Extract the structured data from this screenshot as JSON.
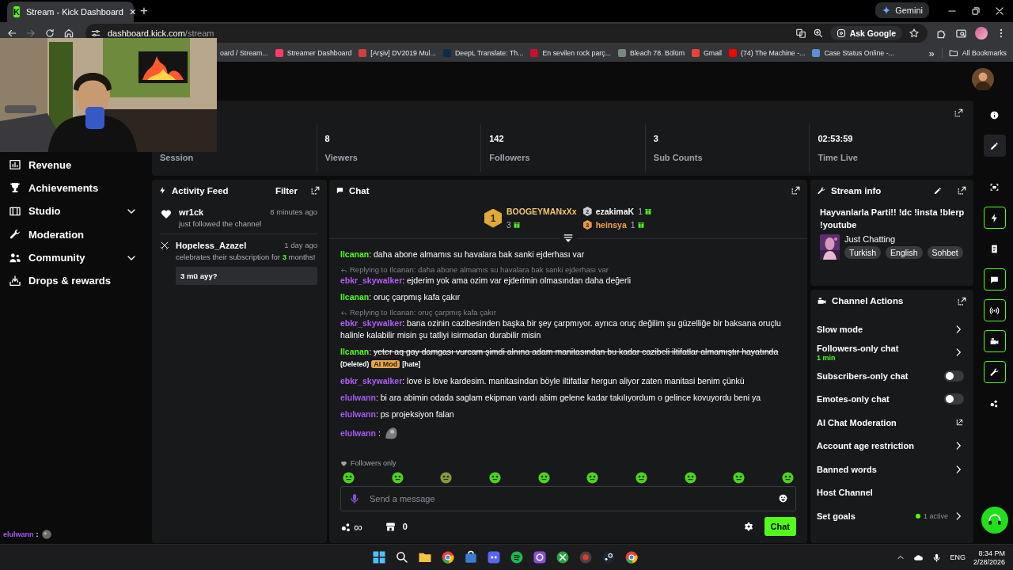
{
  "browser": {
    "tabs": [
      {
        "logo": "K",
        "title": "Stream - Kick Dashboard",
        "close": "×",
        "selected": true
      }
    ],
    "new_tab": "+",
    "gemini": "Gemini",
    "address": {
      "host": "dashboard.kick.com",
      "path": "/stream"
    },
    "ask_google": "Ask Google",
    "bookmarks": [
      "oard / Stream...",
      "Streamer Dashboard",
      "[Arşiv] DV2019 Mul...",
      "DeepL Translate: Th...",
      "En sevilen rock parç...",
      "Bleach 78. Bölüm",
      "Gmail",
      "(74) The Machine -...",
      "Case Status Online -..."
    ],
    "more": "»",
    "all_bookmarks": "All Bookmarks"
  },
  "sidebar": {
    "items": [
      {
        "label": "Revenue",
        "kind": "link"
      },
      {
        "label": "Achievements",
        "kind": "link"
      },
      {
        "label": "Studio",
        "kind": "group"
      },
      {
        "label": "Moderation",
        "kind": "link"
      },
      {
        "label": "Community",
        "kind": "group"
      },
      {
        "label": "Drops & rewards",
        "kind": "link"
      }
    ],
    "chat_preview": {
      "user": "elulwann",
      "separator": ":"
    }
  },
  "stats": [
    {
      "label": "Session"
    },
    {
      "value": "8",
      "label": "Viewers"
    },
    {
      "value": "142",
      "label": "Followers"
    },
    {
      "value": "3",
      "label": "Sub Counts"
    },
    {
      "value": "02:53:59",
      "label": "Time Live"
    }
  ],
  "activity_feed": {
    "title": "Activity Feed",
    "filter": "Filter",
    "items": [
      {
        "kind": "follow",
        "user": "wr1ck",
        "time": "8 minutes ago",
        "text": "just followed the channel"
      },
      {
        "kind": "subscription",
        "user": "Hopeless_Azazel",
        "time": "1 day ago",
        "text": "celebrates their subscription for **3** months!",
        "message": "3 mü ayy?"
      }
    ]
  },
  "chat": {
    "title": "Chat",
    "leaderboard": [
      {
        "rank": "1",
        "user": "BOOGEYMANxXx",
        "gifts": "3",
        "color": "#f2c46d"
      },
      {
        "rank": "2",
        "user": "ezakimaK",
        "gifts": "1",
        "color": "#ffffff"
      },
      {
        "rank": "3",
        "user": "heinsya",
        "gifts": "1",
        "color": "#f0a24a"
      }
    ],
    "messages": [
      {
        "kind": "message",
        "user": "Ilcanan",
        "color": "#53fc18",
        "separator": ":",
        "text": "daha abone almamıs su havalara bak sanki ejderhası var"
      },
      {
        "kind": "message",
        "reply": "Replying to Ilcanan: daha abone almamıs su havalara bak sanki ejderhası var",
        "user": "ebkr_skywalker",
        "color": "#b35df7",
        "separator": ":",
        "text": "ejderim yok ama ozim var ejderimin olmasından daha değerli"
      },
      {
        "kind": "message",
        "user": "Ilcanan",
        "color": "#53fc18",
        "separator": ":",
        "text": "oruç çarpmış kafa çakır"
      },
      {
        "kind": "message",
        "reply": "Replying to Ilcanan: oruç çarpmış kafa çakır",
        "user": "ebkr_skywalker",
        "color": "#b35df7",
        "separator": ":",
        "text": "bana ozinin cazibesinden başka bir şey çarpmıyor. ayrıca oruç değilim şu güzelliğe bir baksana oruçlu halinle kalabilir misin şu tatliyi isirmadan durabilir misin"
      },
      {
        "kind": "deleted",
        "user": "Ilcanan",
        "color": "#53fc18",
        "separator": ":",
        "text": "yeter aq gay damgası vurcam şimdi alnına adam manitasından bu kadar cazibeli iltifatlar almamıştır hayatında",
        "status": "(Deleted)",
        "badge": "AI Mod",
        "reason": "[hate]"
      },
      {
        "kind": "message",
        "user": "ebkr_skywalker",
        "color": "#b35df7",
        "separator": ":",
        "text": "love is love kardesim. manitasindan böyle iltifatlar hergun aliyor zaten manitasi benim çünkü"
      },
      {
        "kind": "message",
        "user": "elulwann",
        "color": "#a35bf0",
        "separator": ":",
        "text": "bi ara abimin odada saglam ekipman vardı abim gelene kadar takılıyordum o gelince kovuyordu beni ya"
      },
      {
        "kind": "message",
        "user": "elulwann",
        "color": "#a35bf0",
        "separator": ":",
        "text": "ps projeksiyon falan"
      },
      {
        "kind": "emote",
        "user": "elulwann",
        "color": "#a35bf0",
        "separator": ":"
      }
    ],
    "followers_only": "Followers only",
    "placeholder": "Send a message",
    "infinity": "∞",
    "store_count": "0",
    "send": "Chat"
  },
  "stream_info": {
    "title": "Stream info",
    "stream_title": "Hayvanlarla Parti!! !dc !insta !blerp !youtube",
    "category": "Just Chatting",
    "tags": [
      "Turkish",
      "English",
      "Sohbet"
    ]
  },
  "channel_actions": {
    "title": "Channel Actions",
    "items": [
      {
        "kind": "link",
        "label": "Slow mode"
      },
      {
        "kind": "link",
        "label": "Followers-only chat",
        "detail": "1 min"
      },
      {
        "kind": "toggle",
        "label": "Subscribers-only chat",
        "on": false
      },
      {
        "kind": "toggle",
        "label": "Emotes-only chat",
        "on": false
      },
      {
        "kind": "external",
        "label": "AI Chat Moderation"
      },
      {
        "kind": "link",
        "label": "Account age restriction"
      },
      {
        "kind": "link",
        "label": "Banned words"
      },
      {
        "kind": "plain",
        "label": "Host Channel"
      },
      {
        "kind": "link",
        "label": "Set goals",
        "status": "1 active"
      }
    ]
  },
  "rail": [
    {
      "on": false,
      "selected": false
    },
    {
      "on": false,
      "selected": true
    },
    {
      "on": false,
      "selected": false
    },
    {
      "on": true,
      "selected": false
    },
    {
      "on": false,
      "selected": false
    },
    {
      "on": true,
      "selected": false
    },
    {
      "on": true,
      "selected": false
    },
    {
      "on": true,
      "selected": false
    },
    {
      "on": true,
      "selected": false
    },
    {
      "on": false,
      "selected": false
    }
  ],
  "taskbar": {
    "language": "ENG",
    "time": "8:34 PM",
    "date": "2/28/2026"
  }
}
